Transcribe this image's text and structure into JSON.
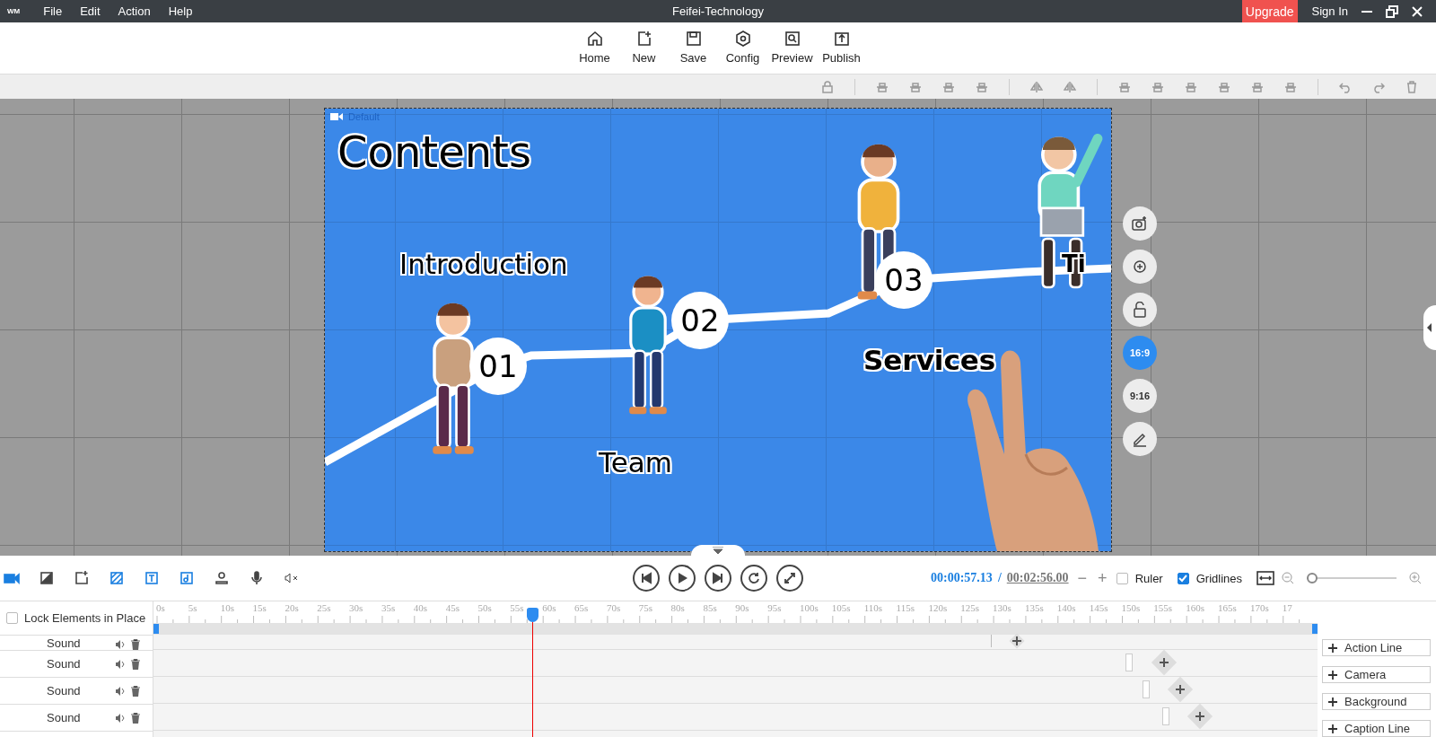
{
  "menu_bar": {
    "logo": "WM",
    "items": [
      "File",
      "Edit",
      "Action",
      "Help"
    ],
    "title": "Feifei-Technology",
    "upgrade": "Upgrade",
    "sign_in": "Sign In"
  },
  "toolbar": [
    {
      "label": "Home",
      "kind": "home"
    },
    {
      "label": "New",
      "kind": "new"
    },
    {
      "label": "Save",
      "kind": "save"
    },
    {
      "label": "Config",
      "kind": "config"
    },
    {
      "label": "Preview",
      "kind": "preview"
    },
    {
      "label": "Publish",
      "kind": "publish"
    }
  ],
  "canvas": {
    "gridlines": true,
    "scene_label": "Default",
    "heading": "Contents",
    "steps": [
      {
        "number": "01",
        "title": "Introduction"
      },
      {
        "number": "02",
        "title": "Team"
      },
      {
        "number": "03",
        "title": "Services"
      }
    ],
    "partial_text": "Ti"
  },
  "aspect_buttons": [
    {
      "label": "16:9",
      "selected": true
    },
    {
      "label": "9:16",
      "selected": false
    }
  ],
  "transport": {
    "current_time": "00:00:57.13",
    "separator": "/",
    "total_time": "00:02:56.00",
    "minus": "−",
    "plus": "+",
    "ruler": {
      "label": "Ruler",
      "checked": false
    },
    "gridlines": {
      "label": "Gridlines",
      "checked": true
    },
    "zoom": {
      "level": 0.0
    }
  },
  "timeline": {
    "lock": {
      "label": "Lock Elements in Place",
      "checked": false
    },
    "ticks": [
      "0s",
      "5s",
      "10s",
      "15s",
      "20s",
      "25s",
      "30s",
      "35s",
      "40s",
      "45s",
      "50s",
      "55s",
      "60s",
      "65s",
      "70s",
      "75s",
      "80s",
      "85s",
      "90s",
      "95s",
      "100s",
      "105s",
      "110s",
      "115s",
      "120s",
      "125s",
      "130s",
      "135s",
      "140s",
      "145s",
      "150s",
      "155s",
      "160s",
      "165s",
      "170s",
      "17"
    ],
    "playhead": {
      "level": 0.325
    },
    "tracks": [
      {
        "name": "Sound"
      },
      {
        "name": "Sound"
      },
      {
        "name": "Sound"
      },
      {
        "name": "Sound"
      }
    ],
    "add_buttons": [
      "Action Line",
      "Camera",
      "Background",
      "Caption Line"
    ]
  }
}
